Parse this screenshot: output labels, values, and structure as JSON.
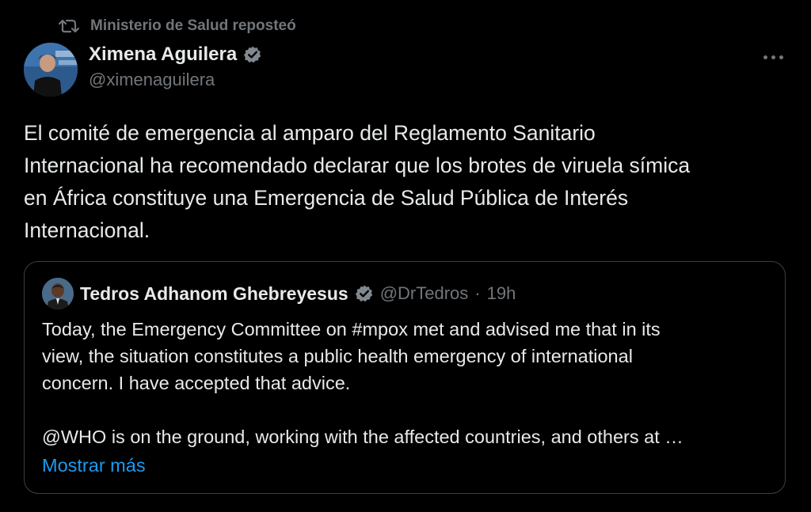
{
  "repost": {
    "icon": "repost-icon",
    "text": "Ministerio de Salud reposteó"
  },
  "author": {
    "name": "Ximena Aguilera",
    "handle": "@ximenaguilera",
    "verified": true,
    "avatar_icon": "avatar-photo"
  },
  "menu": {
    "icon": "more-options-icon"
  },
  "tweet": {
    "text": "El comité de emergencia al amparo del Reglamento Sanitario\nInternacional ha recomendado declarar que los brotes de viruela símica\nen África constituye una Emergencia de Salud Pública de Interés\nInternacional."
  },
  "quote": {
    "author_name": "Tedros Adhanom Ghebreyesus",
    "handle": "@DrTedros",
    "separator": "·",
    "time": "19h",
    "verified": true,
    "text": "Today, the Emergency Committee on #mpox met and advised me that in its\nview, the situation constitutes a public health emergency of international\nconcern. I have accepted that advice.\n\n@WHO is on the ground, working with the affected countries, and others at …",
    "show_more": "Mostrar más"
  },
  "colors": {
    "background": "#000000",
    "text": "#e7e9ea",
    "muted": "#71767b",
    "link": "#1d9bf0",
    "border": "#3a3f44",
    "verified_badge": "#808890"
  }
}
